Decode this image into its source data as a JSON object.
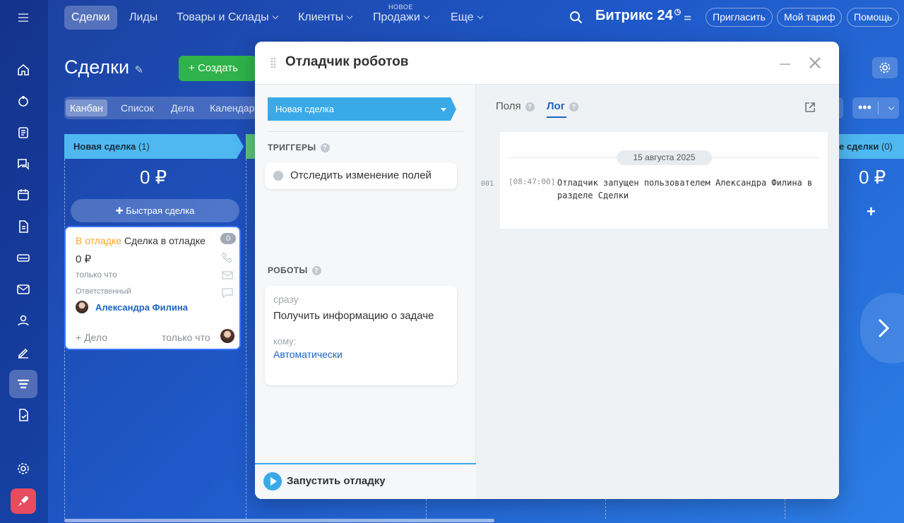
{
  "topnav": {
    "items": [
      {
        "label": "Сделки",
        "active": true
      },
      {
        "label": "Лиды"
      },
      {
        "label": "Товары и Склады",
        "dropdown": true
      },
      {
        "label": "Клиенты",
        "dropdown": true
      },
      {
        "label": "Продажи",
        "dropdown": true,
        "badge": "НОВОЕ"
      },
      {
        "label": "Еще",
        "dropdown": true
      }
    ],
    "logo": "Битрикс 24",
    "invite": "Пригласить",
    "tariff": "Мой тариф",
    "help": "Помощь"
  },
  "page": {
    "title": "Сделки",
    "create": "Создать",
    "views": [
      "Канбан",
      "Список",
      "Дела",
      "Календарь"
    ],
    "more": "•••"
  },
  "kanban": {
    "columns": [
      {
        "name": "Новая сделка",
        "count": "(1)",
        "sum": "0 ₽"
      },
      {
        "name": "е сделки",
        "count": "(0)",
        "sum": "0 ₽"
      }
    ],
    "quick_deal": "Быстрая сделка",
    "add_plus": "+",
    "card": {
      "debug_label": "В отладке",
      "title": "Сделка в отладке",
      "badge": "0",
      "sum": "0 ₽",
      "time": "только что",
      "responsible_label": "Ответственный",
      "responsible": "Александра Филина",
      "add_task": "+ Дело",
      "activity_time": "только что"
    }
  },
  "modal": {
    "title": "Отладчик роботов",
    "stage": "Новая сделка",
    "triggers_label": "ТРИГГЕРЫ",
    "trigger": "Отследить изменение полей",
    "robots_label": "РОБОТЫ",
    "robot": {
      "when": "сразу",
      "name": "Получить информацию о задаче",
      "to_label": "кому:",
      "to_value": "Автоматически"
    },
    "run": "Запустить отладку",
    "tabs": [
      {
        "label": "Поля"
      },
      {
        "label": "Лог",
        "active": true
      }
    ],
    "log": {
      "date": "15 августа 2025",
      "line_no": "001",
      "time": "[08:47:00]",
      "message": "Отладчик запущен пользователем Александра Филина в разделе Сделки"
    }
  },
  "colors": {
    "accent": "#3aa9e8",
    "create": "#2fb34a",
    "link": "#1f64c0",
    "debug": "#f5a623"
  }
}
